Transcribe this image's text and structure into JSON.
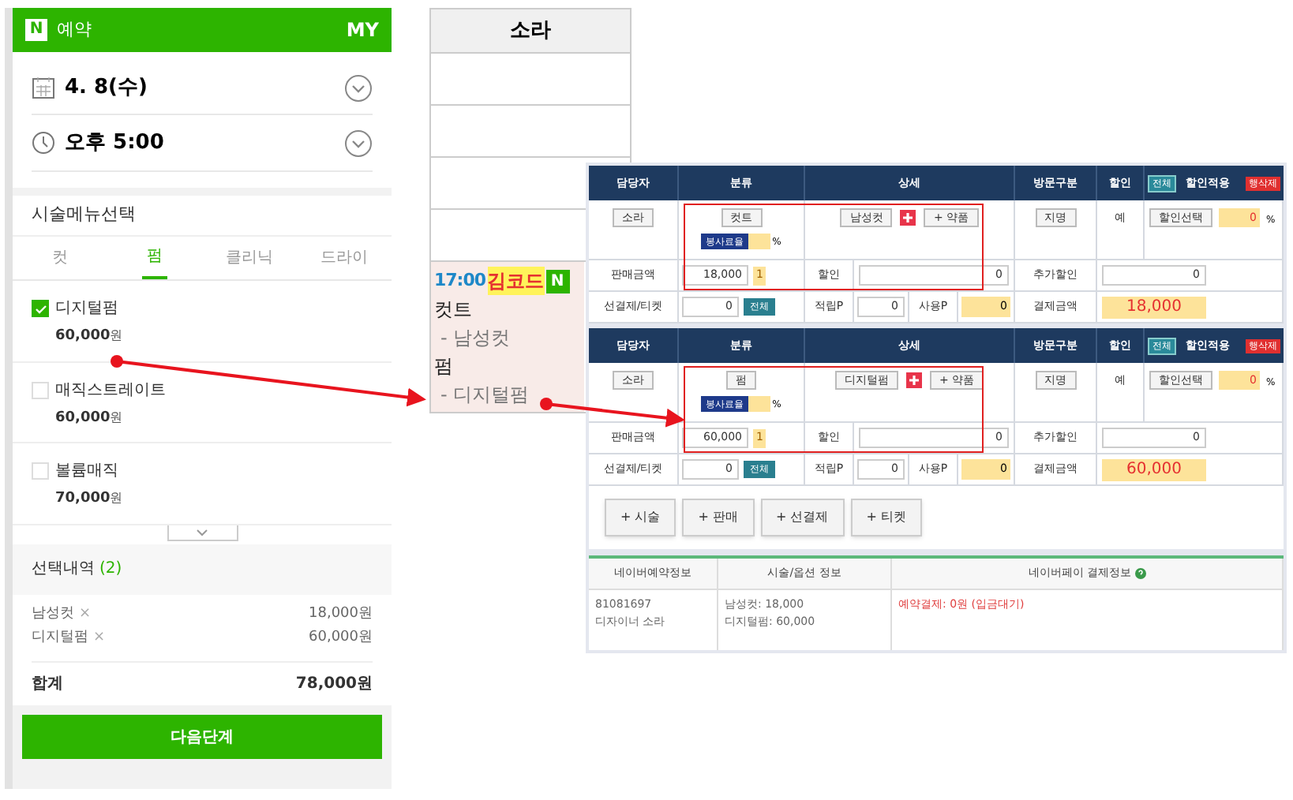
{
  "booking_app": {
    "logo": "N",
    "title": "예약",
    "my": "MY",
    "date": "4. 8(수)",
    "time": "오후 5:00",
    "menu_title": "시술메뉴선택",
    "tabs": [
      {
        "label": "컷",
        "selected": false
      },
      {
        "label": "펌",
        "selected": true
      },
      {
        "label": "클리닉",
        "selected": false
      },
      {
        "label": "드라이",
        "selected": false
      }
    ],
    "items": [
      {
        "name": "디지털펌",
        "price": "60,000",
        "unit": "원",
        "checked": true
      },
      {
        "name": "매직스트레이트",
        "price": "60,000",
        "unit": "원",
        "checked": false
      },
      {
        "name": "볼륨매직",
        "price": "70,000",
        "unit": "원",
        "checked": false
      }
    ],
    "selection": {
      "title": "선택내역",
      "count": "(2)",
      "lines": [
        {
          "name": "남성컷",
          "remove": "×",
          "price": "18,000원"
        },
        {
          "name": "디지털펌",
          "remove": "×",
          "price": "60,000원"
        }
      ],
      "total_label": "합계",
      "total": "78,000원"
    },
    "next_button": "다음단계"
  },
  "schedule": {
    "header": "소라",
    "booking": {
      "time": "17:00",
      "customer": "김코드",
      "badge": "N",
      "lines": [
        {
          "text": "컷트",
          "kind": "category"
        },
        {
          "text": "- 남성컷",
          "kind": "service"
        },
        {
          "text": "펌",
          "kind": "category"
        },
        {
          "text": "- 디지털펌",
          "kind": "service"
        }
      ]
    }
  },
  "pos": {
    "blocks": [
      {
        "header": {
          "staff": "담당자",
          "category": "분류",
          "detail": "상세",
          "visit": "방문구분",
          "discount": "할인",
          "all": "전체",
          "apply": "할인적용",
          "delete": "행삭제"
        },
        "staff": "소라",
        "category": "컷트",
        "service_rate": "봉사료율",
        "percent": "%",
        "service": "남성컷",
        "medicine": "+ 약품",
        "visit": "지명",
        "discount_flag": "예",
        "discount_select": "할인선택",
        "discount_rate": "0",
        "discount_percent": "%",
        "sales_label": "판매금액",
        "sales": "18,000",
        "qty": "1",
        "discount_label": "할인",
        "discount": "0",
        "extra_label": "추가할인",
        "extra": "0",
        "prepaid_label": "선결제/티켓",
        "prepaid": "0",
        "all": "전체",
        "earn_label": "적립P",
        "earn": "0",
        "use_label": "사용P",
        "use": "0",
        "pay_label": "결제금액",
        "pay": "18,000",
        "highlighted": true
      },
      {
        "header": {
          "staff": "담당자",
          "category": "분류",
          "detail": "상세",
          "visit": "방문구분",
          "discount": "할인",
          "all": "전체",
          "apply": "할인적용",
          "delete": "행삭제"
        },
        "staff": "소라",
        "category": "펌",
        "service_rate": "봉사료율",
        "percent": "%",
        "service": "디지털펌",
        "medicine": "+ 약품",
        "visit": "지명",
        "discount_flag": "예",
        "discount_select": "할인선택",
        "discount_rate": "0",
        "discount_percent": "%",
        "sales_label": "판매금액",
        "sales": "60,000",
        "qty": "1",
        "discount_label": "할인",
        "discount": "0",
        "extra_label": "추가할인",
        "extra": "0",
        "prepaid_label": "선결제/티켓",
        "prepaid": "0",
        "all": "전체",
        "earn_label": "적립P",
        "earn": "0",
        "use_label": "사용P",
        "use": "0",
        "pay_label": "결제금액",
        "pay": "60,000",
        "highlighted": true
      }
    ],
    "add_buttons": [
      "+ 시술",
      "+ 판매",
      "+ 선결제",
      "+ 티켓"
    ],
    "naver": {
      "columns": [
        "네이버예약정보",
        "시술/옵션 정보",
        "네이버페이 결제정보"
      ],
      "cells": [
        [
          "81081697",
          "디자이너 소라"
        ],
        [
          "남성컷: 18,000",
          "디지털펌: 60,000"
        ],
        [
          "예약결제: 0원 (입금대기)"
        ]
      ]
    }
  }
}
